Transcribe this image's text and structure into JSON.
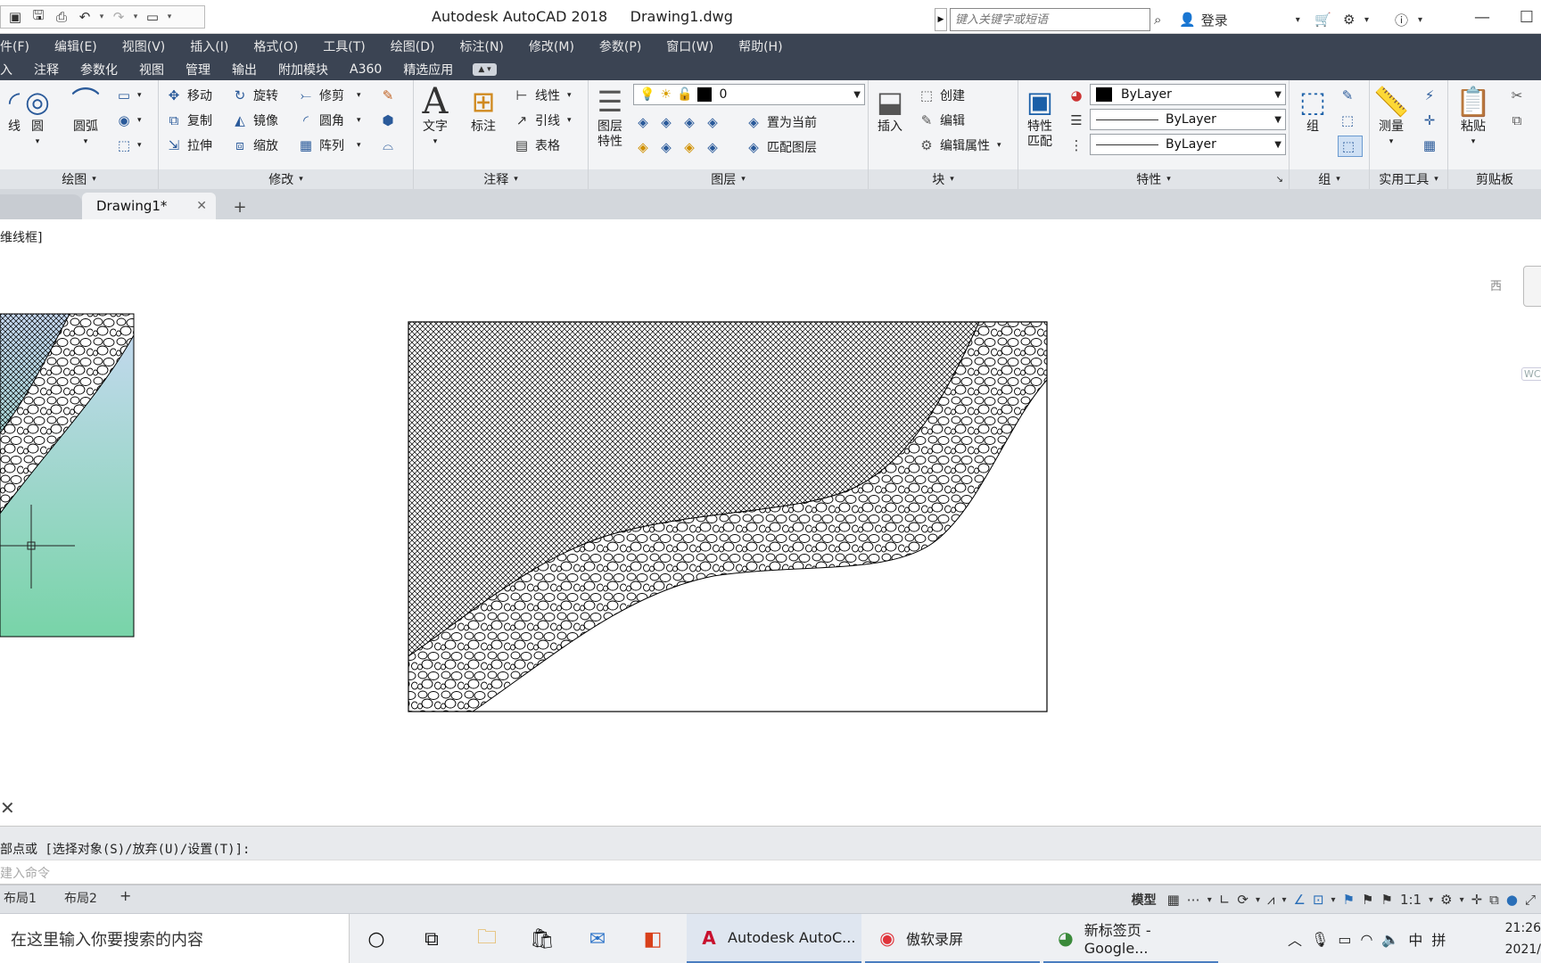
{
  "titlebar": {
    "title": "Autodesk AutoCAD 2018     Drawing1.dwg",
    "search_placeholder": "键入关键字或短语",
    "login": "登录",
    "colors": {
      "menu_bg": "#3b4453",
      "ribbon_bg": "#f3f4f6"
    }
  },
  "menubar": {
    "items": [
      "件(F)",
      "编辑(E)",
      "视图(V)",
      "插入(I)",
      "格式(O)",
      "工具(T)",
      "绘图(D)",
      "标注(N)",
      "修改(M)",
      "参数(P)",
      "窗口(W)",
      "帮助(H)"
    ]
  },
  "ribbon_tabs": [
    "入",
    "注释",
    "参数化",
    "视图",
    "管理",
    "输出",
    "附加模块",
    "A360",
    "精选应用"
  ],
  "ribbon": {
    "draw": {
      "title": "绘图",
      "line": "线",
      "circle": "圆",
      "arc": "圆弧"
    },
    "modify": {
      "title": "修改",
      "move": "移动",
      "rotate": "旋转",
      "trim": "修剪",
      "copy": "复制",
      "mirror": "镜像",
      "fillet": "圆角",
      "stretch": "拉伸",
      "scale": "缩放",
      "array": "阵列"
    },
    "annotation": {
      "title": "注释",
      "text": "文字",
      "dimension": "标注",
      "linear": "线性",
      "leader": "引线",
      "table": "表格"
    },
    "layers": {
      "title": "图层",
      "properties_line1": "图层",
      "properties_line2": "特性",
      "current_layer": "0",
      "set_current": "置为当前",
      "match_layer": "匹配图层"
    },
    "block": {
      "title": "块",
      "insert": "插入",
      "create": "创建",
      "edit": "编辑",
      "edit_attributes": "编辑属性"
    },
    "properties": {
      "title": "特性",
      "match_line1": "特性",
      "match_line2": "匹配",
      "color": "ByLayer",
      "linetype": "ByLayer",
      "lineweight": "ByLayer"
    },
    "groups": {
      "title": "组",
      "group": "组"
    },
    "utilities": {
      "title": "实用工具",
      "measure": "测量"
    },
    "clipboard": {
      "title": "剪贴板",
      "paste": "粘贴"
    }
  },
  "doc_tabs": {
    "active": "Drawing1*"
  },
  "canvas": {
    "viewport_label": "维线框]",
    "viewcube_w": "西",
    "wcs": "WCS"
  },
  "command": {
    "history": "部点或 [选择对象(S)/放弃(U)/设置(T)]:",
    "input_placeholder": "建入命令"
  },
  "status": {
    "layout1": "布局1",
    "layout2": "布局2",
    "model": "模型",
    "scale": "1:1"
  },
  "taskbar": {
    "search": "在这里输入你要搜索的内容",
    "app_autocad": "Autodesk AutoC...",
    "app_recorder": "傲软录屏",
    "app_chrome": "新标签页 - Google...",
    "ime1": "中",
    "ime2": "拼",
    "time": "21:26",
    "date": "2021/"
  }
}
